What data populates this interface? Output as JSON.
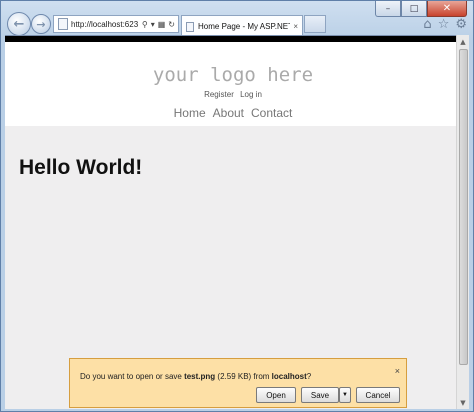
{
  "browser": {
    "address": "http://localhost:623",
    "tab_title": "Home Page - My ASP.NET ...",
    "tab_close": "×",
    "caption": {
      "minimize": "–",
      "maximize": "□",
      "close": "✕"
    },
    "icons": [
      "home-icon",
      "star-icon",
      "gear-icon"
    ]
  },
  "site": {
    "logo": "your logo here",
    "login": {
      "register": "Register",
      "login": "Log in"
    },
    "menu": [
      "Home",
      "About",
      "Contact"
    ],
    "heading": "Hello World!"
  },
  "download_bar": {
    "prefix": "Do you want to open or save ",
    "filename": "test.png",
    "size": "(2.59 KB)",
    "mid": " from ",
    "host": "localhost",
    "suffix": "?",
    "open": "Open",
    "save": "Save",
    "cancel": "Cancel",
    "close": "×"
  }
}
